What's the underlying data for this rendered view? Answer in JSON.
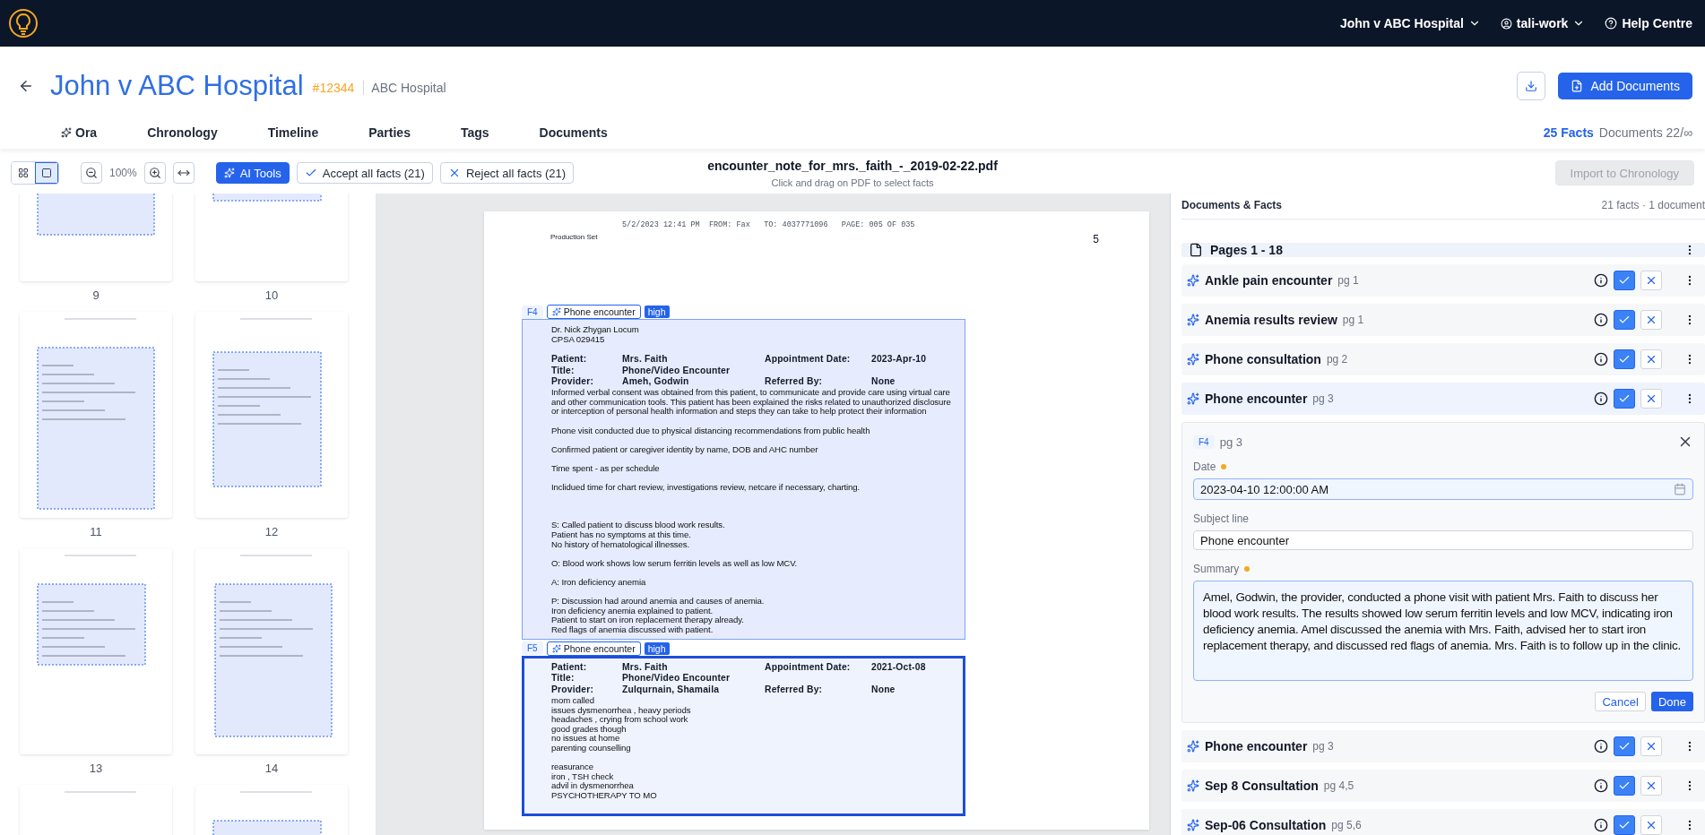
{
  "topbar": {
    "case_menu": "John v ABC Hospital",
    "user_menu": "tali-work",
    "help": "Help Centre"
  },
  "case": {
    "title": "John v ABC Hospital",
    "number": "#12344",
    "client": "ABC Hospital",
    "add_documents": "Add Documents"
  },
  "tabs": [
    {
      "label": "Ora",
      "kind": "ai"
    },
    {
      "label": "Chronology",
      "kind": "plain"
    },
    {
      "label": "Timeline",
      "kind": "plain"
    },
    {
      "label": "Parties",
      "kind": "plain"
    },
    {
      "label": "Tags",
      "kind": "plain"
    },
    {
      "label": "Documents",
      "kind": "plain"
    }
  ],
  "counts": {
    "facts": "25 Facts",
    "documents": "Documents 22/∞"
  },
  "toolbar": {
    "view_modes": [
      {
        "kind": "grid",
        "selected": false
      },
      {
        "kind": "single",
        "selected": true
      }
    ],
    "zoom": "100%",
    "ai_tools": "AI Tools",
    "accept_all": "Accept all facts (21)",
    "reject_all": "Reject all facts (21)",
    "file_name": "encounter_note_for_mrs._faith_-_2019-02-22.pdf",
    "hint": "Click and drag on PDF to select facts",
    "import": {
      "label": "Import to Chronology",
      "disabled": true
    }
  },
  "thumbnails": [
    {
      "kind": "page",
      "label": "9"
    },
    {
      "kind": "page",
      "label": "10"
    },
    {
      "kind": "page",
      "label": "11"
    },
    {
      "kind": "page",
      "label": "12"
    },
    {
      "kind": "page",
      "label": "13"
    },
    {
      "kind": "page",
      "label": "14"
    },
    {
      "kind": "page"
    },
    {
      "kind": "page"
    }
  ],
  "pdf": {
    "fax_header": "5/2/2023 12:41 PM  FROM: Fax   TO: 4037771096   PAGE: 005 OF 035",
    "production": "Production Set",
    "page_number": "5",
    "facts": [
      {
        "id": "F4",
        "label": "Phone encounter",
        "confidence": "high",
        "selected": false,
        "content": [
          {
            "kind": "text",
            "text": "Dr. Nick Zhygan Locum"
          },
          {
            "kind": "text",
            "text": "CPSA 029415"
          },
          {
            "kind": "gap"
          },
          {
            "kind": "field",
            "label": "Patient:",
            "value": "Mrs. Faith",
            "label2": "Appointment Date:",
            "value2": "2023-Apr-10"
          },
          {
            "kind": "field",
            "label": "Title:",
            "value": "Phone/Video Encounter"
          },
          {
            "kind": "field",
            "label": "Provider:",
            "value": "Ameh, Godwin",
            "label2": "Referred By:",
            "value2": "None"
          },
          {
            "kind": "text",
            "text": "Informed verbal consent was obtained from this patient, to communicate and provide care using virtual care and other communication tools. This patient has been explained the risks related to unauthorized disclosure or interception of personal health information and steps they can take to help protect their information"
          },
          {
            "kind": "gap"
          },
          {
            "kind": "text",
            "text": "Phone visit conducted due to physical distancing recommendations from public health"
          },
          {
            "kind": "gap"
          },
          {
            "kind": "text",
            "text": "Confirmed patient or caregiver identity by name, DOB and AHC number"
          },
          {
            "kind": "gap"
          },
          {
            "kind": "text",
            "text": "Time spent - as per schedule"
          },
          {
            "kind": "gap"
          },
          {
            "kind": "text",
            "text": "Inclidued time for chart review, investigations review, netcare if necessary, charting."
          },
          {
            "kind": "gap"
          },
          {
            "kind": "gap"
          },
          {
            "kind": "gap"
          },
          {
            "kind": "text",
            "text": "S: Called patient to discuss blood work results."
          },
          {
            "kind": "text",
            "text": "Patient has no symptoms at this time."
          },
          {
            "kind": "text",
            "text": "No history of hematological illnesses."
          },
          {
            "kind": "gap"
          },
          {
            "kind": "text",
            "text": "O: Blood work shows low serum ferritin levels as well as low MCV."
          },
          {
            "kind": "gap"
          },
          {
            "kind": "text",
            "text": "A: Iron deficiency anemia"
          },
          {
            "kind": "gap"
          },
          {
            "kind": "text",
            "text": "P: Discussion had around anemia and causes of anemia."
          },
          {
            "kind": "text",
            "text": "Iron deficiency anemia explained to patient."
          },
          {
            "kind": "text",
            "text": "Patient to start on iron replacement therapy already."
          },
          {
            "kind": "text",
            "text": "Red flags of anemia discussed with patient."
          }
        ]
      },
      {
        "id": "F5",
        "label": "Phone encounter",
        "confidence": "high",
        "selected": true,
        "content": [
          {
            "kind": "field",
            "label": "Patient:",
            "value": "Mrs. Faith",
            "label2": "Appointment Date:",
            "value2": "2021-Oct-08"
          },
          {
            "kind": "field",
            "label": "Title:",
            "value": "Phone/Video Encounter"
          },
          {
            "kind": "field",
            "label": "Provider:",
            "value": "Zulqurnain, Shamaila",
            "label2": "Referred By:",
            "value2": "None"
          },
          {
            "kind": "text",
            "text": "mom called"
          },
          {
            "kind": "text",
            "text": "issues dysmenorrhea , heavy periods"
          },
          {
            "kind": "text",
            "text": "headaches ,  crying from school work"
          },
          {
            "kind": "text",
            "text": "good grades though"
          },
          {
            "kind": "text",
            "text": "no issues at home"
          },
          {
            "kind": "text",
            "text": "parenting counselling"
          },
          {
            "kind": "gap"
          },
          {
            "kind": "text",
            "text": "reasurance"
          },
          {
            "kind": "text",
            "text": "iron , TSH  check"
          },
          {
            "kind": "text",
            "text": "advil in dysmenorrhea"
          },
          {
            "kind": "text",
            "text": "PSYCHOTHERAPY TO MO"
          }
        ]
      }
    ]
  },
  "panel": {
    "title": "Documents & Facts",
    "summary": "21 facts · 1 document",
    "group": {
      "title": "Pages 1 - 18"
    },
    "facts": [
      {
        "title": "Ankle pain encounter",
        "page": "pg 1",
        "accepted": true,
        "expanded": false
      },
      {
        "title": "Anemia results review",
        "page": "pg 1",
        "accepted": true,
        "expanded": false
      },
      {
        "title": "Phone consultation",
        "page": "pg 2",
        "accepted": true,
        "expanded": false
      },
      {
        "title": "Phone encounter",
        "page": "pg 3",
        "accepted": true,
        "expanded": true,
        "editor": {
          "fact_id": "F4",
          "page": "pg 3",
          "date_label": "Date",
          "date_modified": true,
          "date_value": "2023-04-10 12:00:00 AM",
          "subject_label": "Subject line",
          "subject_value": "Phone encounter",
          "summary_label": "Summary",
          "summary_modified": true,
          "summary": "Amel, Godwin, the provider, conducted a phone visit with patient Mrs. Faith to discuss her blood work results. The results showed low serum ferritin levels and low MCV, indicating iron deficiency anemia. Amel discussed the anemia with Mrs. Faith, advised her to start iron replacement therapy, and discussed red flags of anemia. Mrs. Faith is to follow up in the clinic.",
          "cancel": "Cancel",
          "done": "Done"
        }
      },
      {
        "title": "Phone encounter",
        "page": "pg 3",
        "accepted": true,
        "expanded": false
      },
      {
        "title": "Sep 8 Consultation",
        "page": "pg 4,5",
        "accepted": true,
        "expanded": false
      },
      {
        "title": "Sep-06 Consultation",
        "page": "pg 5,6",
        "accepted": true,
        "expanded": false
      }
    ]
  }
}
